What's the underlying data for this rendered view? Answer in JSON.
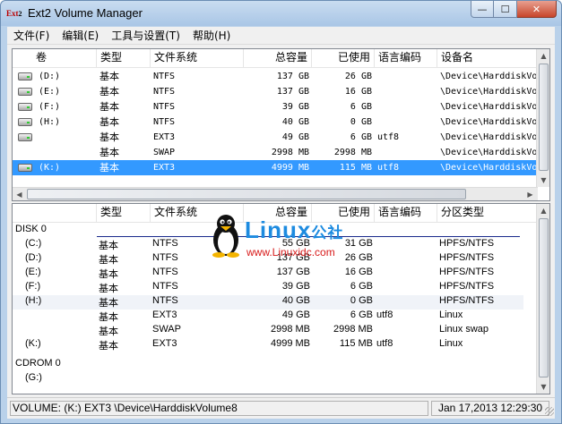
{
  "window": {
    "title": "Ext2 Volume Manager",
    "icon": "ext2-app-icon",
    "icon_text": "Ext",
    "icon_suffix": "2",
    "minimize": "—",
    "maximize": "☐",
    "close": "✕"
  },
  "menu": [
    "文件(F)",
    "编辑(E)",
    "工具与设置(T)",
    "帮助(H)"
  ],
  "volumes_table": {
    "columns": [
      "卷",
      "类型",
      "文件系统",
      "总容量",
      "已使用",
      "语言编码",
      "设备名"
    ],
    "rows": [
      {
        "vol": "(D:)",
        "type": "基本",
        "fs": "NTFS",
        "total": "137 GB",
        "used": "26 GB",
        "codepage": "",
        "device": "\\Device\\HarddiskVolume",
        "icon": "hard-drive-icon",
        "selected": false
      },
      {
        "vol": "(E:)",
        "type": "基本",
        "fs": "NTFS",
        "total": "137 GB",
        "used": "16 GB",
        "codepage": "",
        "device": "\\Device\\HarddiskVolume",
        "icon": "hard-drive-icon",
        "selected": false
      },
      {
        "vol": "(F:)",
        "type": "基本",
        "fs": "NTFS",
        "total": "39 GB",
        "used": "6 GB",
        "codepage": "",
        "device": "\\Device\\HarddiskVolume",
        "icon": "hard-drive-icon",
        "selected": false
      },
      {
        "vol": "(H:)",
        "type": "基本",
        "fs": "NTFS",
        "total": "40 GB",
        "used": "0 GB",
        "codepage": "",
        "device": "\\Device\\HarddiskVolume",
        "icon": "hard-drive-icon",
        "selected": false
      },
      {
        "vol": "",
        "type": "基本",
        "fs": "EXT3",
        "total": "49 GB",
        "used": "6 GB",
        "codepage": "utf8",
        "device": "\\Device\\HarddiskVolume",
        "icon": "hard-drive-icon",
        "selected": false
      },
      {
        "vol": "",
        "type": "基本",
        "fs": "SWAP",
        "total": "2998 MB",
        "used": "2998 MB",
        "codepage": "",
        "device": "\\Device\\HarddiskVolume",
        "icon": "",
        "selected": false
      },
      {
        "vol": "(K:)",
        "type": "基本",
        "fs": "EXT3",
        "total": "4999 MB",
        "used": "115 MB",
        "codepage": "utf8",
        "device": "\\Device\\HarddiskVolume",
        "icon": "hard-drive-icon",
        "selected": true
      }
    ]
  },
  "disks_table": {
    "columns": [
      "",
      "类型",
      "文件系统",
      "总容量",
      "已使用",
      "语言编码",
      "分区类型"
    ],
    "groups": [
      {
        "name": "DISK 0",
        "rows": [
          {
            "vol": "(C:)",
            "type": "基本",
            "fs": "NTFS",
            "total": "55 GB",
            "used": "31 GB",
            "codepage": "",
            "ptype": "HPFS/NTFS"
          },
          {
            "vol": "(D:)",
            "type": "基本",
            "fs": "NTFS",
            "total": "137 GB",
            "used": "26 GB",
            "codepage": "",
            "ptype": "HPFS/NTFS"
          },
          {
            "vol": "(E:)",
            "type": "基本",
            "fs": "NTFS",
            "total": "137 GB",
            "used": "16 GB",
            "codepage": "",
            "ptype": "HPFS/NTFS"
          },
          {
            "vol": "(F:)",
            "type": "基本",
            "fs": "NTFS",
            "total": "39 GB",
            "used": "6 GB",
            "codepage": "",
            "ptype": "HPFS/NTFS"
          },
          {
            "vol": "(H:)",
            "type": "基本",
            "fs": "NTFS",
            "total": "40 GB",
            "used": "0 GB",
            "codepage": "",
            "ptype": "HPFS/NTFS"
          },
          {
            "vol": "",
            "type": "基本",
            "fs": "EXT3",
            "total": "49 GB",
            "used": "6 GB",
            "codepage": "utf8",
            "ptype": "Linux"
          },
          {
            "vol": "",
            "type": "基本",
            "fs": "SWAP",
            "total": "2998 MB",
            "used": "2998 MB",
            "codepage": "",
            "ptype": "Linux swap"
          },
          {
            "vol": "(K:)",
            "type": "基本",
            "fs": "EXT3",
            "total": "4999 MB",
            "used": "115 MB",
            "codepage": "utf8",
            "ptype": "Linux"
          }
        ]
      },
      {
        "name": "CDROM 0",
        "rows": [
          {
            "vol": "(G:)",
            "type": "",
            "fs": "",
            "total": "",
            "used": "",
            "codepage": "",
            "ptype": ""
          }
        ]
      }
    ]
  },
  "watermark": {
    "logo": "Linux",
    "suffix": "公社",
    "url": "www.Linuxidc.com"
  },
  "status": {
    "left": "VOLUME: (K:) EXT3 \\Device\\HarddiskVolume8",
    "right": "Jan 17,2013 12:29:30"
  },
  "colors": {
    "selection": "#3399ff",
    "group_line": "#1b2b8c",
    "watermark_blue": "#1d8be0",
    "watermark_red": "#d81b1b"
  }
}
